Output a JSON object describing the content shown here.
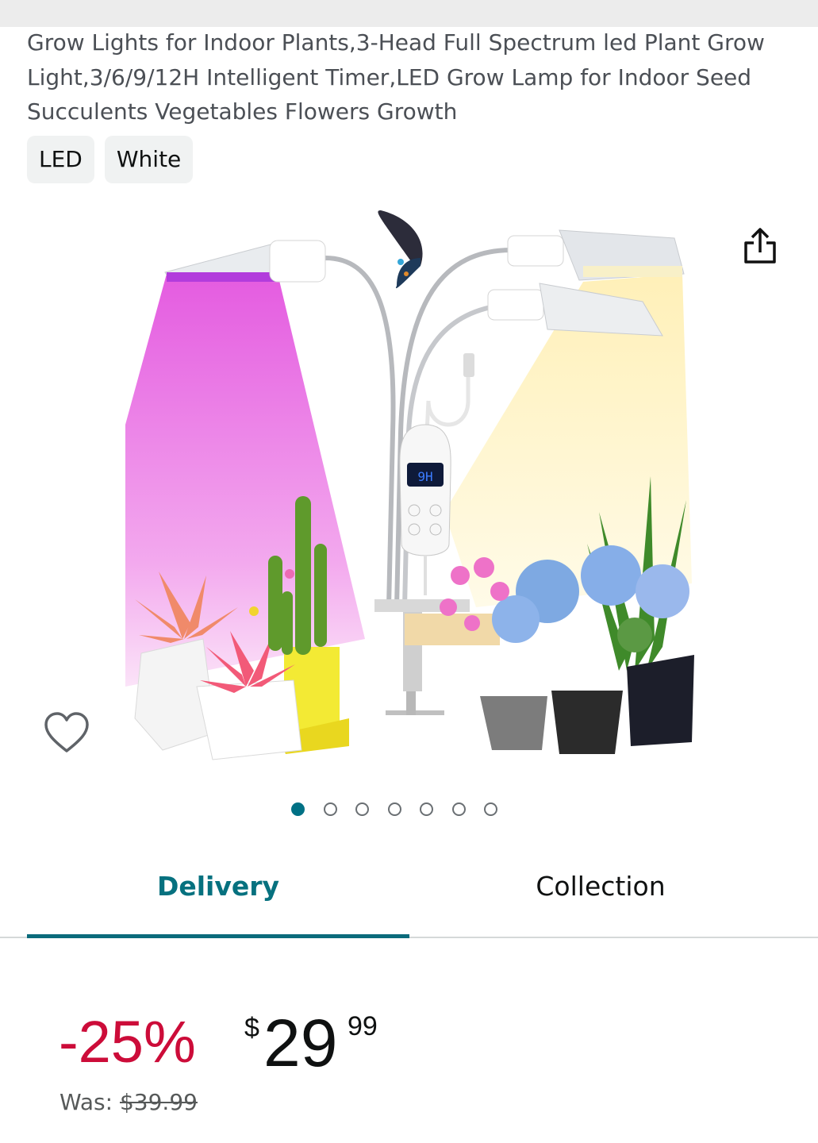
{
  "product": {
    "title": "Grow Lights for Indoor Plants,3-Head Full Spectrum led Plant Grow Light,3/6/9/12H Intelligent Timer,LED Grow Lamp for Indoor Seed Succulents Vegetables Flowers Growth",
    "chips": [
      "LED",
      "White"
    ]
  },
  "gallery": {
    "timer_display": "9H",
    "image_count": 7,
    "active_index": 0
  },
  "icons": {
    "share": "share-icon",
    "wishlist": "heart-icon"
  },
  "tabs": {
    "delivery": "Delivery",
    "collection": "Collection",
    "active": "delivery"
  },
  "pricing": {
    "discount": "-25%",
    "currency_symbol": "$",
    "price_whole": "29",
    "price_fraction": "99",
    "was_label": "Was:",
    "was_price": "$39.99"
  },
  "colors": {
    "accent": "#007185",
    "discount_red": "#cc0c39"
  }
}
